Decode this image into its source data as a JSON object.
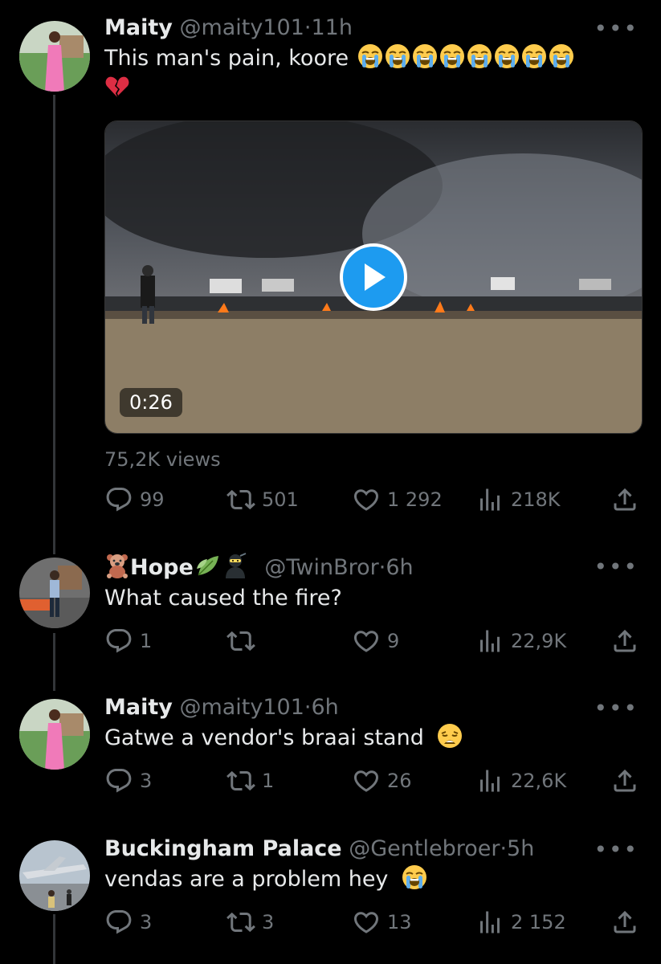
{
  "colors": {
    "background": "#000000",
    "text": "#e7e9ea",
    "muted": "#71767b",
    "accent": "#1d9bf0",
    "line": "#333639"
  },
  "tweets": [
    {
      "name": "Maity",
      "handle": "@maity101",
      "sep": "·",
      "time": "11h",
      "text": "This man's pain, koore",
      "emojis": [
        "loudly-crying-face",
        "loudly-crying-face",
        "loudly-crying-face",
        "loudly-crying-face",
        "loudly-crying-face",
        "loudly-crying-face",
        "loudly-crying-face",
        "loudly-crying-face",
        "broken-heart"
      ],
      "media": {
        "duration": "0:26",
        "icon": "play-icon"
      },
      "views": "75,2K views",
      "replies": "99",
      "reposts": "501",
      "likes": "1 292",
      "analytics": "218K"
    },
    {
      "name": "Hope",
      "name_emojis": [
        "teddy-bear",
        "leaf",
        "ninja"
      ],
      "handle": "@TwinBror",
      "sep": "·",
      "time": "6h",
      "text": "What caused the fire?",
      "replies": "1",
      "reposts": "",
      "likes": "9",
      "analytics": "22,9K"
    },
    {
      "name": "Maity",
      "handle": "@maity101",
      "sep": "·",
      "time": "6h",
      "text": "Gatwe a vendor's braai stand",
      "emojis": [
        "weary-face"
      ],
      "replies": "3",
      "reposts": "1",
      "likes": "26",
      "analytics": "22,6K"
    },
    {
      "name": "Buckingham Palace",
      "handle": "@Gentlebroer",
      "sep": "·",
      "time": "5h",
      "text": "vendas are a problem hey",
      "emojis": [
        "loudly-crying-face"
      ],
      "replies": "3",
      "reposts": "3",
      "likes": "13",
      "analytics": "2 152"
    }
  ],
  "more_label": "•••"
}
